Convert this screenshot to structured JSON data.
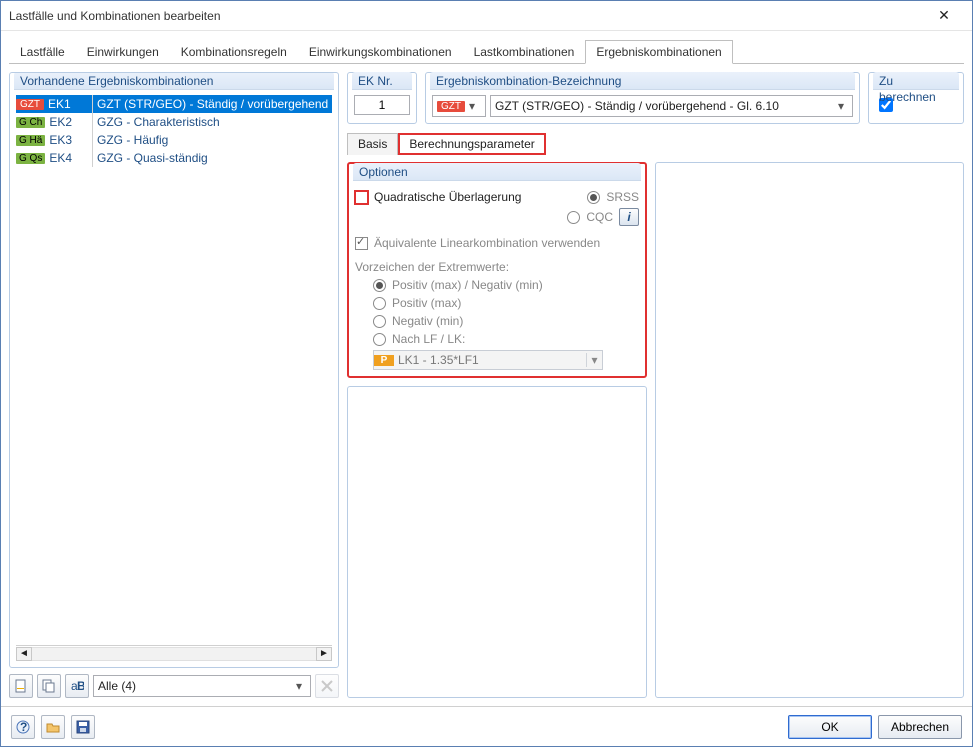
{
  "window": {
    "title": "Lastfälle und Kombinationen bearbeiten"
  },
  "tabs": {
    "items": [
      "Lastfälle",
      "Einwirkungen",
      "Kombinationsregeln",
      "Einwirkungskombinationen",
      "Lastkombinationen",
      "Ergebniskombinationen"
    ],
    "active": 5
  },
  "left": {
    "legend": "Vorhandene Ergebniskombinationen",
    "rows": [
      {
        "tag": "GZT",
        "tagColor": "red",
        "code": "EK1",
        "desc": "GZT (STR/GEO) - Ständig / vorübergehend",
        "selected": true
      },
      {
        "tag": "G Ch",
        "tagColor": "green",
        "code": "EK2",
        "desc": "GZG - Charakteristisch",
        "selected": false
      },
      {
        "tag": "G Hä",
        "tagColor": "green",
        "code": "EK3",
        "desc": "GZG - Häufig",
        "selected": false
      },
      {
        "tag": "G Qs",
        "tagColor": "green",
        "code": "EK4",
        "desc": "GZG - Quasi-ständig",
        "selected": false
      }
    ],
    "filter": "Alle (4)"
  },
  "ekn": {
    "legend": "EK Nr.",
    "value": "1"
  },
  "bez": {
    "legend": "Ergebniskombination-Bezeichnung",
    "typeTag": "GZT",
    "value": "GZT (STR/GEO) - Ständig / vorübergehend - Gl. 6.10"
  },
  "zb": {
    "legend": "Zu berechnen",
    "checked": true
  },
  "subtabs": {
    "items": [
      "Basis",
      "Berechnungsparameter"
    ],
    "active": 1
  },
  "options": {
    "legend": "Optionen",
    "quadLabel": "Quadratische Überlagerung",
    "srssLabel": "SRSS",
    "cqcLabel": "CQC",
    "linLabel": "Äquivalente Linearkombination verwenden",
    "signHeading": "Vorzeichen der Extremwerte:",
    "signOptions": [
      "Positiv (max) / Negativ (min)",
      "Positiv (max)",
      "Negativ (min)",
      "Nach LF / LK:"
    ],
    "lkBadge": "P",
    "lkValue": "LK1 - 1.35*LF1"
  },
  "footer": {
    "ok": "OK",
    "cancel": "Abbrechen"
  }
}
